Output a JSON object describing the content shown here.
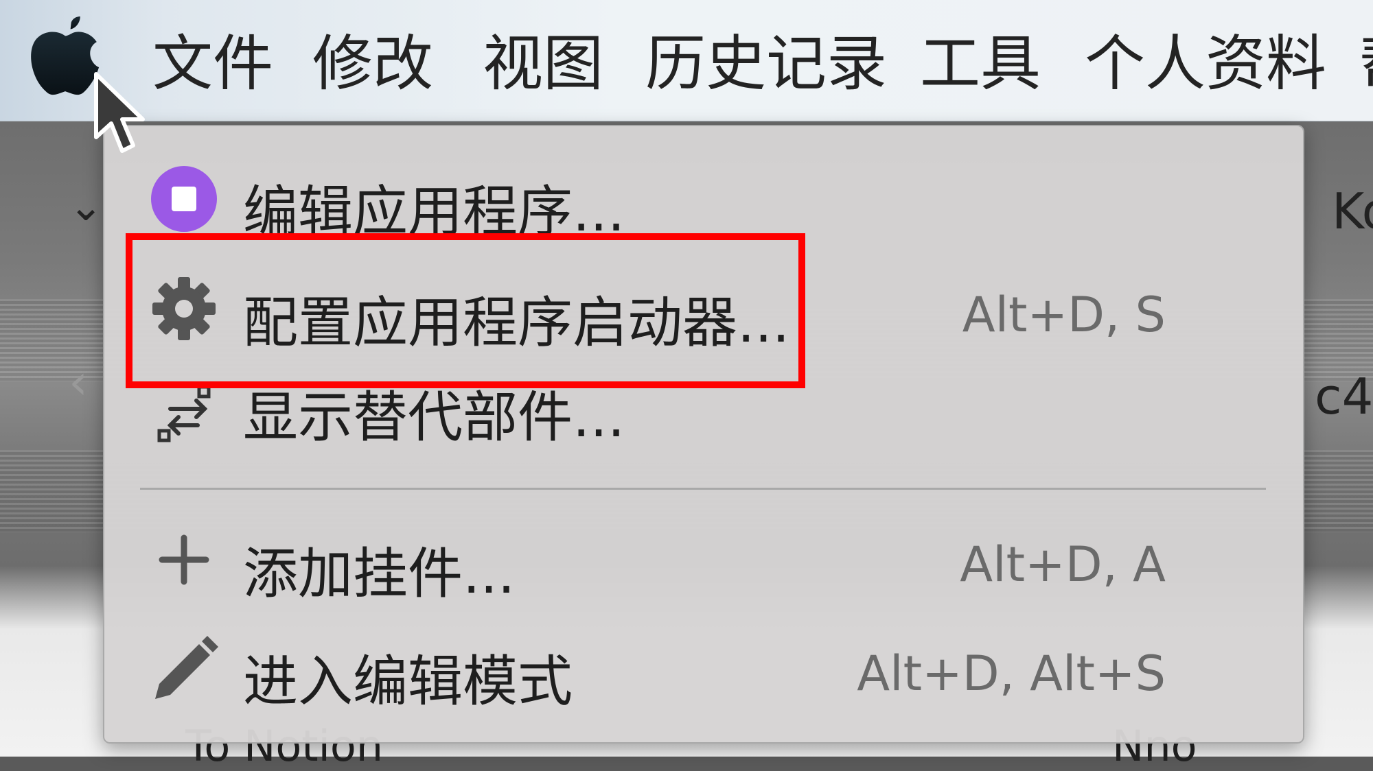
{
  "menubar": {
    "items": [
      "文件",
      "修改",
      "视图",
      "历史记录",
      "工具",
      "个人资料",
      "帮"
    ]
  },
  "dropdown": {
    "items": [
      {
        "label": "编辑应用程序...",
        "shortcut": "",
        "icon": "app-circle-icon"
      },
      {
        "label": "配置应用程序启动器...",
        "shortcut": "Alt+D, S",
        "icon": "gear-icon"
      },
      {
        "label": "显示替代部件...",
        "shortcut": "",
        "icon": "swap-arrows-icon"
      },
      {
        "label": "添加挂件...",
        "shortcut": "Alt+D, A",
        "icon": "plus-icon"
      },
      {
        "label": "进入编辑模式",
        "shortcut": "Alt+D, Alt+S",
        "icon": "pencil-icon"
      }
    ]
  },
  "background": {
    "right_text_1": "Ko",
    "right_text_2": "c4",
    "bottom_left_text": "To Notion",
    "bottom_right_text": "Nno"
  },
  "colors": {
    "highlight": "#ff0000",
    "app_icon": "#9b59e6"
  }
}
